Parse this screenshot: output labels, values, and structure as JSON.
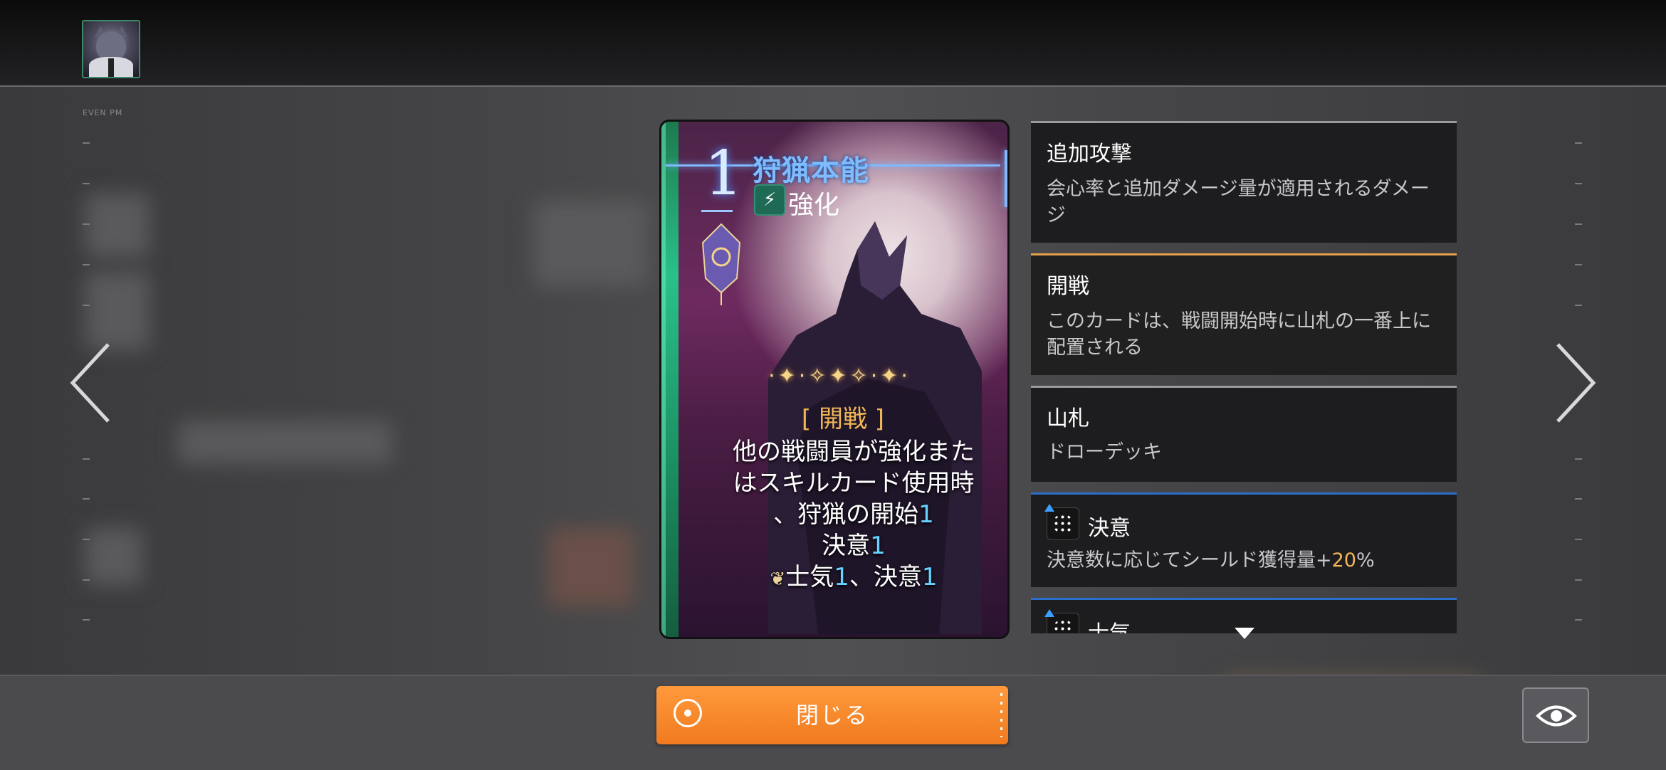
{
  "card": {
    "cost": "1",
    "name": "狩猟本能",
    "type": "強化",
    "tag": "[ 開戦 ]",
    "description": {
      "line1": "他の戦闘員が強化また",
      "line2": "はスキルカード使用時",
      "line3_text": "、狩猟の開始",
      "line3_num": "1",
      "line4_text": "決意",
      "line4_num": "1",
      "line5_a": "士気",
      "line5_num_a": "1",
      "line5_b": "、決意",
      "line5_num_b": "1"
    }
  },
  "glossary": [
    {
      "title": "追加攻撃",
      "body": "会心率と追加ダメージ量が適用されるダメージ"
    },
    {
      "title": "開戦",
      "body": "このカードは、戦闘開始時に山札の一番上に配置される"
    },
    {
      "title": "山札",
      "body": "ドローデッキ"
    },
    {
      "title": "決意",
      "body_prefix": "決意数に応じてシールド獲得量+",
      "body_value": "20",
      "body_suffix": "%"
    },
    {
      "title": "士気"
    }
  ],
  "background_label": "EVEN PM",
  "buttons": {
    "close_label": "閉じる"
  },
  "icons": {
    "avatar": "avatar-portrait",
    "prev": "chevron-left-icon",
    "next": "chevron-right-icon",
    "close": "target-icon",
    "view": "eye-icon"
  },
  "colors": {
    "accent_orange": "#f07a1f",
    "keyword_orange": "#f2b655",
    "number_blue": "#66d2ff",
    "card_name_blue": "#7fbcff"
  }
}
